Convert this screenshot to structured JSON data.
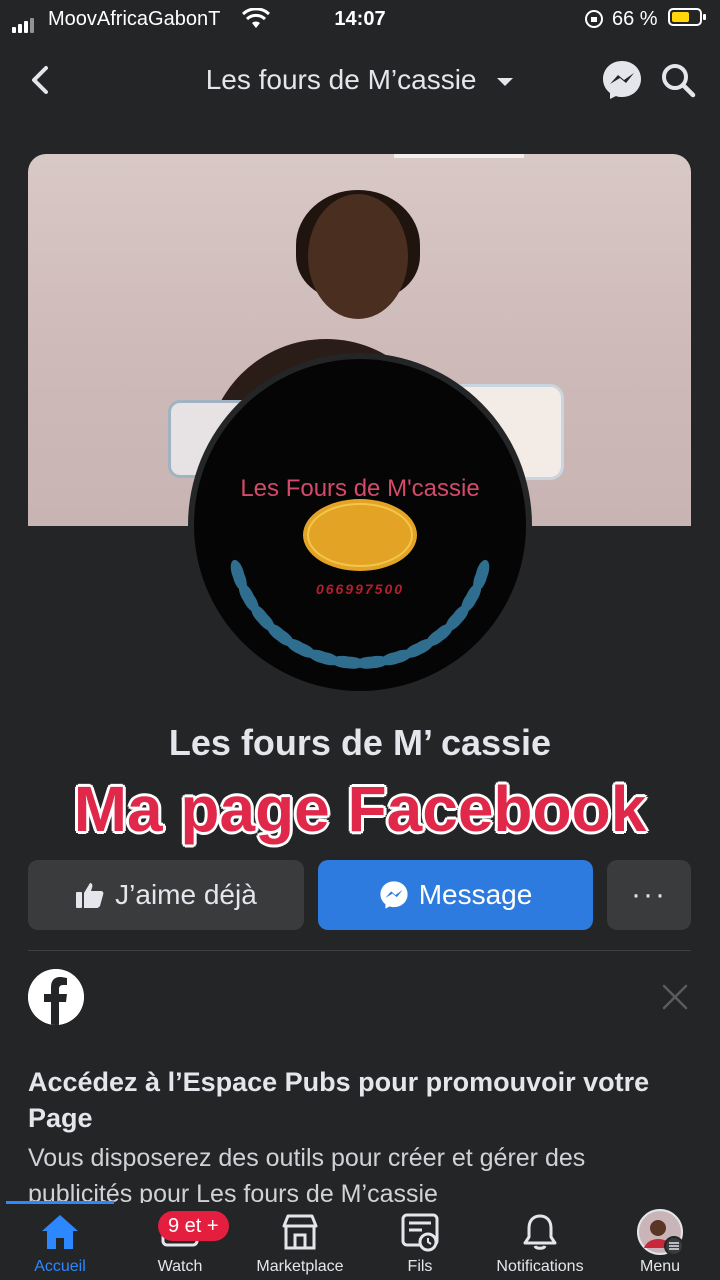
{
  "status_bar": {
    "carrier": "MoovAfricaGabonT",
    "time": "14:07",
    "battery_percent": "66 %",
    "battery_level": 0.66
  },
  "header": {
    "title": "Les fours de M’cassie",
    "back_icon": "chevron-left-icon",
    "dropdown_icon": "caret-down-icon",
    "messenger_icon": "messenger-icon",
    "search_icon": "search-icon"
  },
  "profile": {
    "logo_title": "Les Fours de M'cassie",
    "logo_phone": "066997500",
    "page_name": "Les fours de M’ cassie",
    "overlay_caption": "Ma page Facebook"
  },
  "actions": {
    "like_label": "J’aime déjà",
    "message_label": "Message",
    "more_label": "···"
  },
  "promo": {
    "title": "Accédez à l’Espace Pubs pour promouvoir votre Page",
    "description": "Vous disposerez des outils pour créer et gérer des publicités pour Les fours de M’cassie"
  },
  "tabbar": {
    "tabs": [
      {
        "label": "Accueil",
        "icon": "home-icon",
        "active": true
      },
      {
        "label": "Watch",
        "icon": "watch-icon",
        "active": false
      },
      {
        "label": "Marketplace",
        "icon": "marketplace-icon",
        "active": false
      },
      {
        "label": "Fils",
        "icon": "feeds-icon",
        "active": false
      },
      {
        "label": "Notifications",
        "icon": "bell-icon",
        "active": false
      },
      {
        "label": "Menu",
        "icon": "avatar-menu-icon",
        "active": false
      }
    ],
    "watch_badge": "9 et +"
  },
  "colors": {
    "background": "#242526",
    "accent": "#2d88ff",
    "message_button": "#2d7bdf",
    "badge": "#e41e3f",
    "overlay_text": "#e0284a"
  }
}
